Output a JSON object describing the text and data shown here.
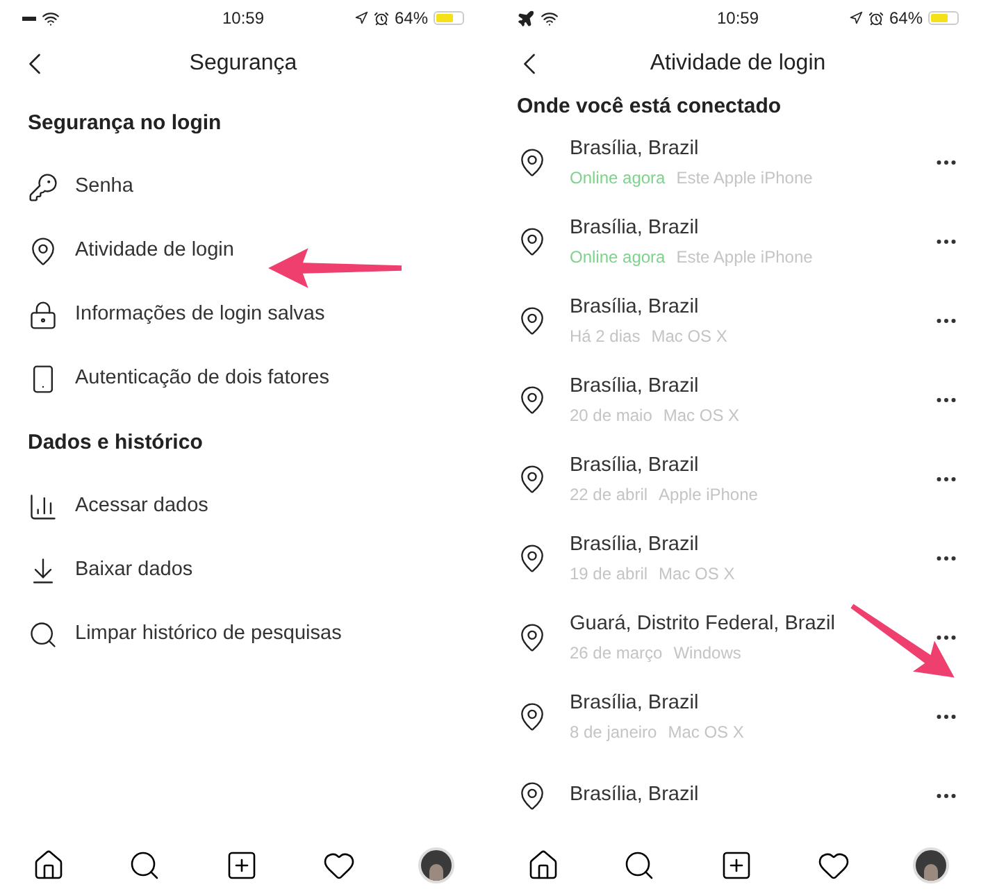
{
  "screens": [
    {
      "status_bar": {
        "time": "10:59",
        "battery": "64%",
        "airplane": false
      },
      "title": "Segurança",
      "kind": "menu",
      "sections": [
        {
          "title": "Segurança no login",
          "items": [
            {
              "label": "Senha"
            },
            {
              "label": "Atividade de login"
            },
            {
              "label": "Informações de login salvas"
            },
            {
              "label": "Autenticação de dois fatores"
            }
          ]
        },
        {
          "title": "Dados e histórico",
          "items": [
            {
              "label": "Acessar dados"
            },
            {
              "label": "Baixar dados"
            },
            {
              "label": "Limpar histórico de pesquisas"
            }
          ]
        }
      ]
    },
    {
      "status_bar": {
        "time": "10:59",
        "battery": "64%",
        "airplane": true
      },
      "title": "Atividade de login",
      "kind": "sessions",
      "section_title": "Onde você está conectado",
      "sessions": [
        {
          "location": "Brasília, Brazil",
          "when": "Online agora",
          "online": true,
          "device": "Este Apple iPhone"
        },
        {
          "location": "Brasília, Brazil",
          "when": "Online agora",
          "online": true,
          "device": "Este Apple iPhone"
        },
        {
          "location": "Brasília, Brazil",
          "when": "Há 2 dias",
          "online": false,
          "device": "Mac OS X"
        },
        {
          "location": "Brasília, Brazil",
          "when": "20 de maio",
          "online": false,
          "device": "Mac OS X"
        },
        {
          "location": "Brasília, Brazil",
          "when": "22 de abril",
          "online": false,
          "device": "Apple iPhone"
        },
        {
          "location": "Brasília, Brazil",
          "when": "19 de abril",
          "online": false,
          "device": "Mac OS X"
        },
        {
          "location": "Guará, Distrito Federal, Brazil",
          "when": "26 de março",
          "online": false,
          "device": "Windows"
        },
        {
          "location": "Brasília, Brazil",
          "when": "8 de janeiro",
          "online": false,
          "device": "Mac OS X"
        },
        {
          "location": "Brasília, Brazil"
        }
      ]
    }
  ]
}
